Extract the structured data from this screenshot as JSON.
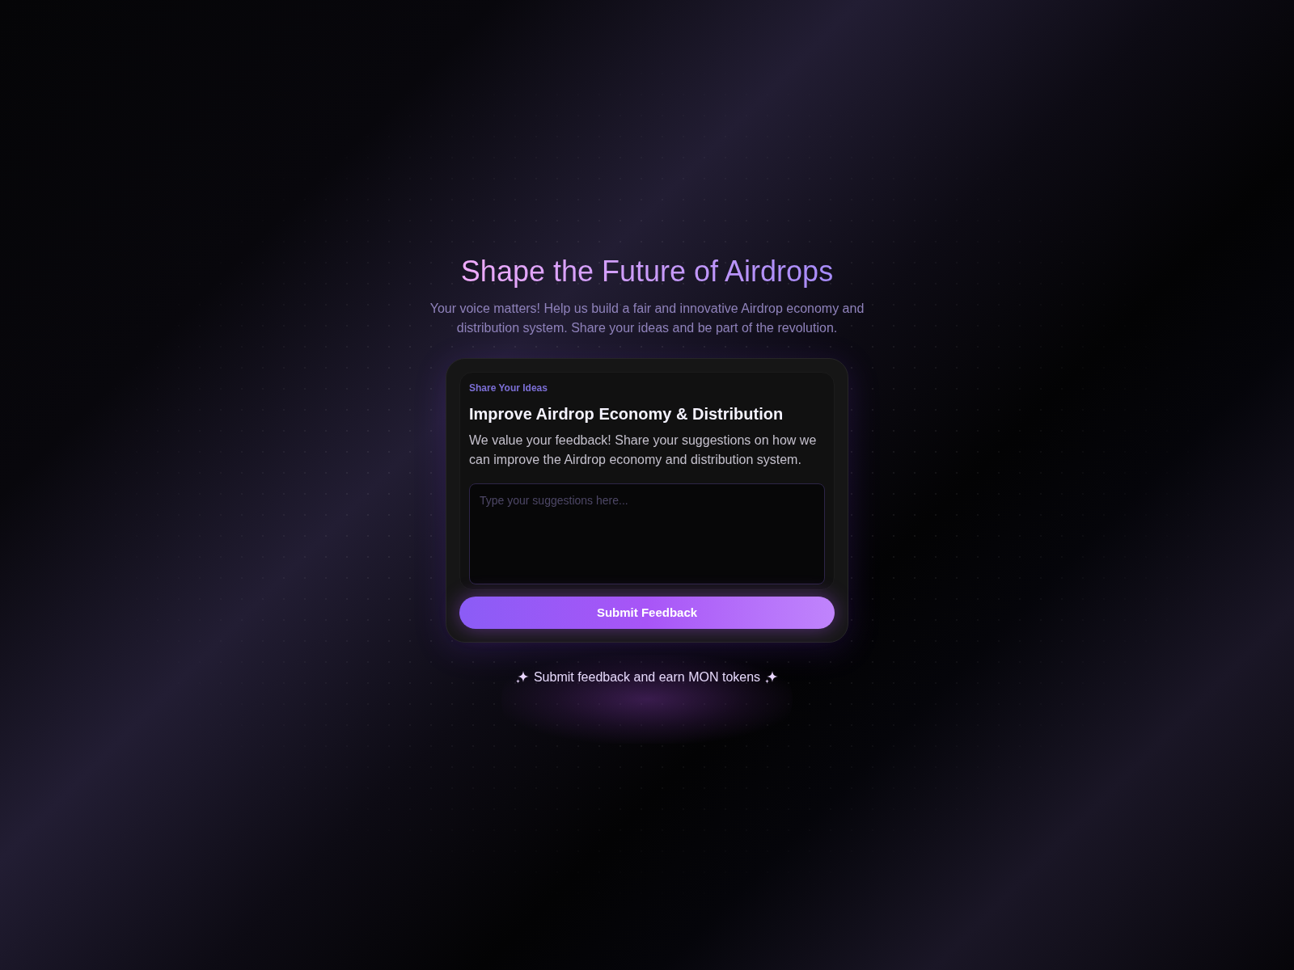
{
  "hero": {
    "title": "Shape the Future of Airdrops",
    "subtitle": "Your voice matters! Help us build a fair and innovative Airdrop economy and distribution system. Share your ideas and be part of the revolution."
  },
  "card": {
    "eyebrow": "Share Your Ideas",
    "heading": "Improve Airdrop Economy & Distribution",
    "description": "We value your feedback! Share your suggestions on how we can improve the Airdrop economy and distribution system.",
    "textarea": {
      "placeholder": "Type your suggestions here..."
    },
    "submit_button": "Submit Feedback"
  },
  "footer_note": "Submit feedback and earn MON tokens"
}
